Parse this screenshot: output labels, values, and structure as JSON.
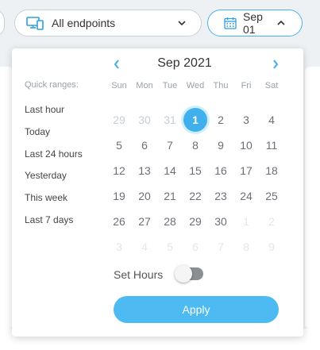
{
  "toolbar": {
    "endpoint_select": {
      "label": "All endpoints",
      "icon": "devices-icon"
    },
    "date_button": {
      "label": "Sep 01",
      "icon": "calendar-icon"
    }
  },
  "picker": {
    "quick_ranges_title": "Quick ranges:",
    "quick_ranges": [
      "Last hour",
      "Today",
      "Last 24 hours",
      "Yesterday",
      "This week",
      "Last 7 days"
    ],
    "month_title": "Sep 2021",
    "weekdays": [
      "Sun",
      "Mon",
      "Tue",
      "Wed",
      "Thu",
      "Fri",
      "Sat"
    ],
    "weeks": [
      [
        {
          "d": "29",
          "s": "muted"
        },
        {
          "d": "30",
          "s": "muted"
        },
        {
          "d": "31",
          "s": "muted"
        },
        {
          "d": "1",
          "s": "selected"
        },
        {
          "d": "2",
          "s": ""
        },
        {
          "d": "3",
          "s": ""
        },
        {
          "d": "4",
          "s": ""
        }
      ],
      [
        {
          "d": "5",
          "s": ""
        },
        {
          "d": "6",
          "s": ""
        },
        {
          "d": "7",
          "s": ""
        },
        {
          "d": "8",
          "s": ""
        },
        {
          "d": "9",
          "s": ""
        },
        {
          "d": "10",
          "s": ""
        },
        {
          "d": "11",
          "s": ""
        }
      ],
      [
        {
          "d": "12",
          "s": ""
        },
        {
          "d": "13",
          "s": ""
        },
        {
          "d": "14",
          "s": ""
        },
        {
          "d": "15",
          "s": ""
        },
        {
          "d": "16",
          "s": ""
        },
        {
          "d": "17",
          "s": ""
        },
        {
          "d": "18",
          "s": ""
        }
      ],
      [
        {
          "d": "19",
          "s": ""
        },
        {
          "d": "20",
          "s": ""
        },
        {
          "d": "21",
          "s": ""
        },
        {
          "d": "22",
          "s": ""
        },
        {
          "d": "23",
          "s": ""
        },
        {
          "d": "24",
          "s": ""
        },
        {
          "d": "25",
          "s": ""
        }
      ],
      [
        {
          "d": "26",
          "s": ""
        },
        {
          "d": "27",
          "s": ""
        },
        {
          "d": "28",
          "s": ""
        },
        {
          "d": "29",
          "s": ""
        },
        {
          "d": "30",
          "s": ""
        },
        {
          "d": "1",
          "s": "faint"
        },
        {
          "d": "2",
          "s": "faint"
        }
      ],
      [
        {
          "d": "3",
          "s": "faint"
        },
        {
          "d": "4",
          "s": "faint"
        },
        {
          "d": "5",
          "s": "faint"
        },
        {
          "d": "6",
          "s": "faint"
        },
        {
          "d": "7",
          "s": "faint"
        },
        {
          "d": "8",
          "s": "faint"
        },
        {
          "d": "9",
          "s": "faint"
        }
      ]
    ],
    "set_hours_label": "Set Hours",
    "set_hours_on": false,
    "apply_label": "Apply",
    "accent_color": "#3fb0ec"
  }
}
